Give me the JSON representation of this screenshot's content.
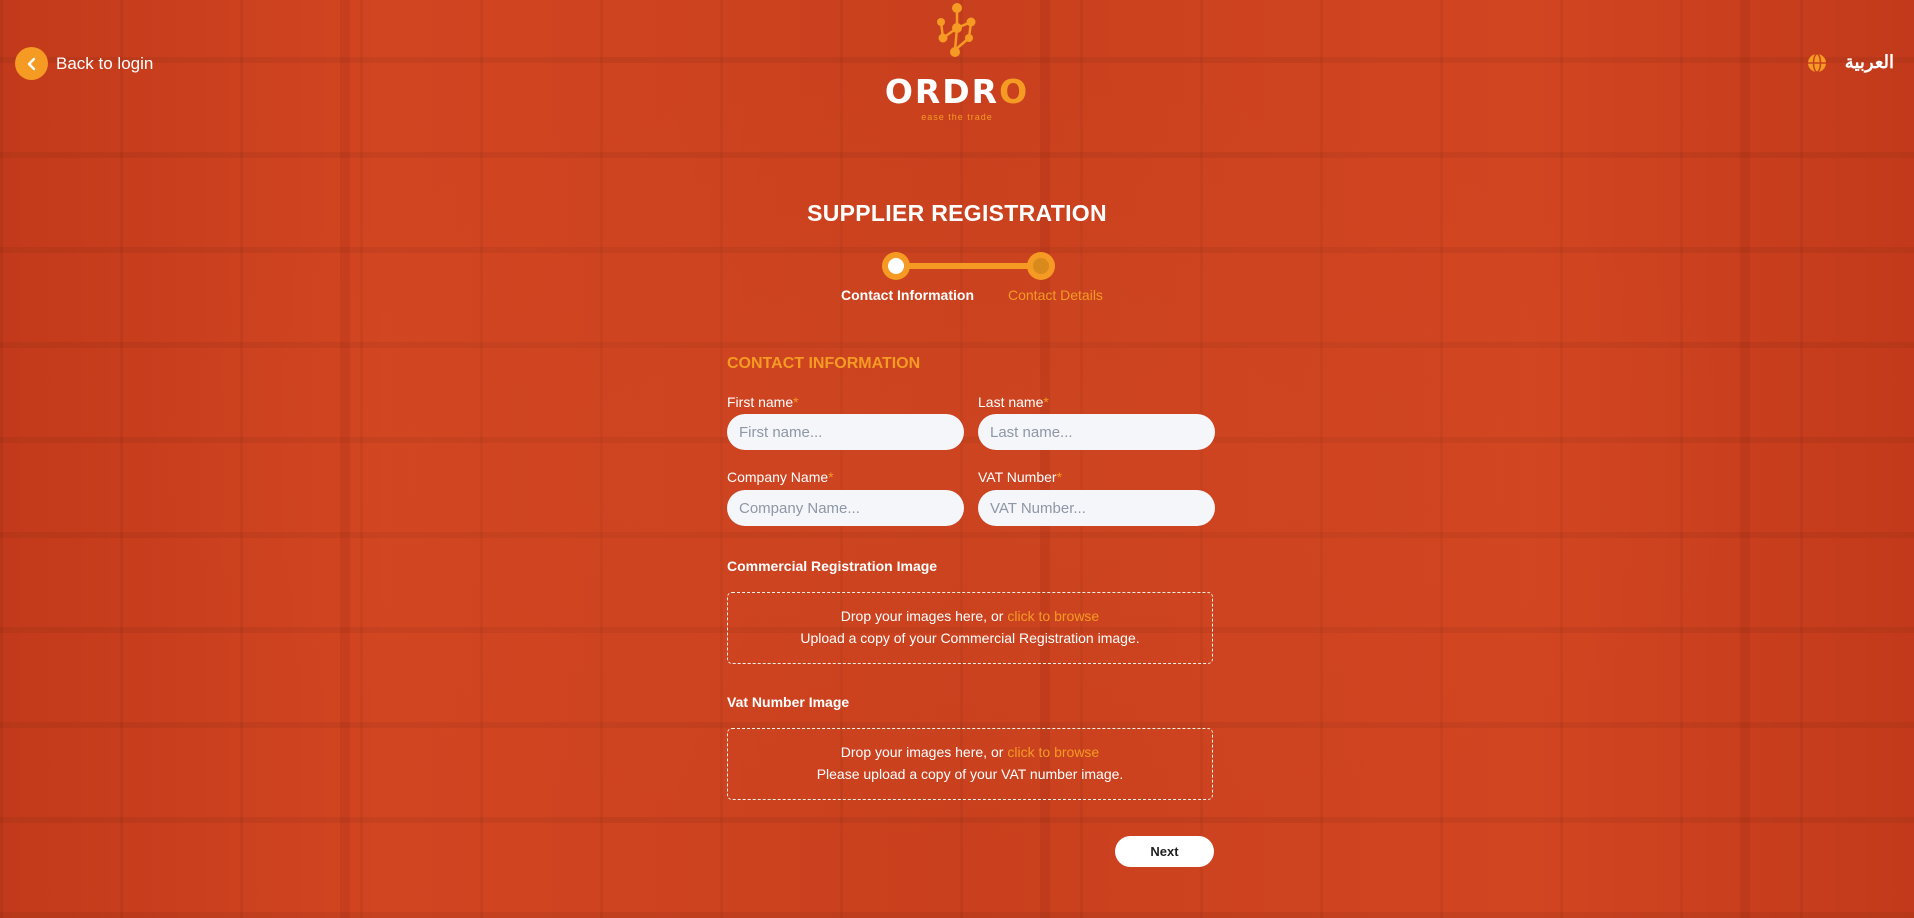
{
  "nav": {
    "back_label": "Back to login",
    "language_label": "العربية"
  },
  "brand": {
    "name_start": "ORDR",
    "name_end": "O",
    "tagline": "ease the trade",
    "accent_color": "#f59a23",
    "icon": "molecule-logo-icon"
  },
  "page": {
    "title": "SUPPLIER REGISTRATION"
  },
  "stepper": {
    "steps": [
      {
        "label": "Contact Information",
        "state": "active"
      },
      {
        "label": "Contact Details",
        "state": "upcoming"
      }
    ]
  },
  "form": {
    "section_title": "CONTACT INFORMATION",
    "required_marker": "*",
    "first_name": {
      "label": "First name",
      "placeholder": "First name...",
      "value": ""
    },
    "last_name": {
      "label": "Last name",
      "placeholder": "Last name...",
      "value": ""
    },
    "company_name": {
      "label": "Company Name",
      "placeholder": "Company Name...",
      "value": ""
    },
    "vat_number": {
      "label": "VAT Number",
      "placeholder": "VAT Number...",
      "value": ""
    },
    "cr_image": {
      "label": "Commercial Registration Image",
      "drop_text": "Drop your images here, or",
      "browse_text": "click to browse",
      "hint": "Upload a copy of your Commercial Registration image."
    },
    "vat_image": {
      "label": "Vat Number Image",
      "drop_text": "Drop your images here, or",
      "browse_text": "click to browse",
      "hint": "Please upload a copy of your VAT number image."
    },
    "next_label": "Next"
  }
}
